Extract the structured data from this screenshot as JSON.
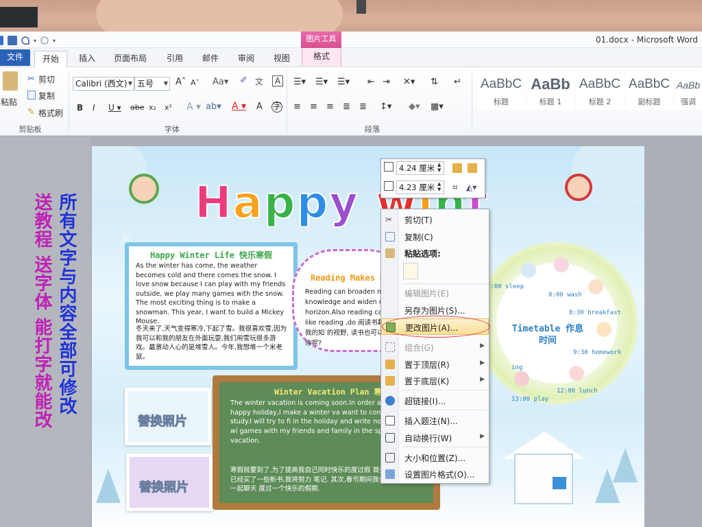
{
  "titlebar": {
    "doc_title": "01.docx  -  Microsoft Word",
    "pic_tools_band": "图片工具"
  },
  "tabs": {
    "file": "文件",
    "home": "开始",
    "insert": "插入",
    "page_layout": "页面布局",
    "references": "引用",
    "mailings": "邮件",
    "review": "审阅",
    "view": "视图",
    "format": "格式"
  },
  "ribbon": {
    "clipboard": {
      "paste": "粘贴",
      "cut": "剪切",
      "copy": "复制",
      "format_painter": "格式刷",
      "label": "剪贴板"
    },
    "font": {
      "name": "Calibri (西文)",
      "size": "五号",
      "label": "字体"
    },
    "paragraph": {
      "label": "段落"
    },
    "styles": [
      {
        "sample": "AaBbC",
        "name": "标题"
      },
      {
        "sample": "AaBb",
        "name": "标题 1"
      },
      {
        "sample": "AaBbC",
        "name": "标题 2"
      },
      {
        "sample": "AaBbC",
        "name": "副标题"
      },
      {
        "sample": "AaBb",
        "name": "强调"
      }
    ]
  },
  "side_promo": {
    "right_column": "所有文字与内容全部可修改",
    "left_column": "送教程 送字体 能打字就能改"
  },
  "poster": {
    "title": "Happy winter life",
    "card1": {
      "title": "Happy Winter Life 快乐寒假",
      "en": "As the winter has come, the weather becomes cold and there comes the snow. I love snow because I can play with my friends outside, we play many games with the snow. The most exciting thing is to make a snowman. This year, I want to build a Mickey Mouse.",
      "cn": "冬天来了,天气变得寒冷,下起了雪。我很喜欢雪,因为我可以和我的朋友在外面玩耍,我们用雪玩很多游戏。最激动人心的是堆雪人。今年,我想堆一个米老鼠。"
    },
    "cloud": {
      "title": "Reading Makes M",
      "text": "Reading can broaden m knowledge and widen m horizon.Also reading ca happy.I like reading ,do 阅读书籍可以拓宽我的知 的视野, 读书也可以使我 读书,你呢?"
    },
    "board": {
      "title": "Winter Vacation Plan 寒",
      "en": "The winter vacation is coming soon.In order and enjoy a happy holiday,I make a winter va want to continue with my study.I will try to fi in the holiday and write notes. Secondly,I wi games with my friends and family in the spri enjoy the vacation.",
      "cn": "寒假就要到了,为了提高我自己同时快乐的度过假 首先,我会继续学习,我已经买了一些新书,我将努力 笔记. 其次,春节期间我会和我的家人朋友一起聊天 度过一个快乐的假期."
    },
    "photo_label": "替换照片",
    "timetable": {
      "title": "Timetable 作息时间",
      "items": [
        {
          "time": "7:00 sleep"
        },
        {
          "time": "8:00 wash"
        },
        {
          "time": "8:30 breakfast"
        },
        {
          "time": "9:30 homework"
        },
        {
          "time": "12:00 lunch"
        },
        {
          "time": "13:00 play"
        },
        {
          "time": "ing"
        }
      ]
    }
  },
  "size_toolbar": {
    "height": "4.24 厘米",
    "width": "4.23 厘米"
  },
  "context_menu": {
    "items": [
      {
        "label": "剪切(T)",
        "icon": "scissors-icon"
      },
      {
        "label": "复制(C)",
        "icon": "copy-icon"
      },
      {
        "label": "粘贴选项:",
        "icon": "paste-icon"
      },
      {
        "label": "编辑图片(E)",
        "icon": ""
      },
      {
        "label": "另存为图片(S)...",
        "icon": ""
      },
      {
        "label": "更改图片(A)...",
        "icon": "change-picture-icon"
      },
      {
        "label": "组合(G)",
        "icon": "group-icon"
      },
      {
        "label": "置于顶层(R)",
        "icon": "bring-front-icon"
      },
      {
        "label": "置于底层(K)",
        "icon": "send-back-icon"
      },
      {
        "label": "超链接(I)...",
        "icon": "hyperlink-icon"
      },
      {
        "label": "插入题注(N)...",
        "icon": "caption-icon"
      },
      {
        "label": "自动换行(W)",
        "icon": "wrap-text-icon"
      },
      {
        "label": "大小和位置(Z)...",
        "icon": "size-position-icon"
      },
      {
        "label": "设置图片格式(O)...",
        "icon": "format-picture-icon"
      }
    ]
  },
  "colors": {
    "ribbon_file_tab": "#2a62b8",
    "picture_tools": "#e86aa8",
    "highlight_ellipse": "#e23a3a",
    "promo_blue": "#1f33d8",
    "promo_magenta": "#c020b5"
  }
}
